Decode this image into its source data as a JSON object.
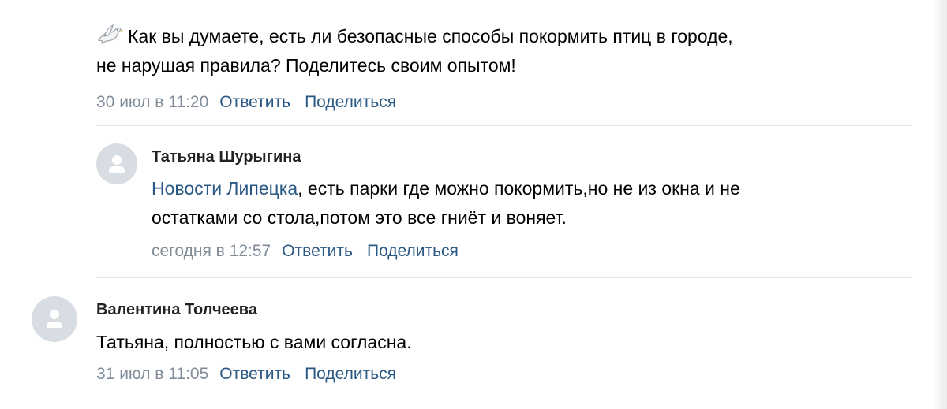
{
  "post": {
    "text_icon": "dove-icon",
    "text_line1": "Как вы думаете, есть ли безопасные способы покормить птиц в городе,",
    "text_line2": "не нарушая правила? Поделитесь своим опытом!",
    "date": "30 июл в 11:20",
    "reply_label": "Ответить",
    "share_label": "Поделиться"
  },
  "comments": [
    {
      "author": "Татьяна Шурыгина",
      "avatar_icon": "default-avatar-icon",
      "mention": "Новости Липецка",
      "text_line1_rest": ", есть парки где можно покормить,но не из окна и не",
      "text_line2": "остатками со стола,потом это все гниёт и воняет.",
      "date": "сегодня в 12:57",
      "reply_label": "Ответить",
      "share_label": "Поделиться"
    },
    {
      "author": "Валентина Толчеева",
      "avatar_icon": "default-avatar-icon",
      "text": "Татьяна, полностью с вами согласна.",
      "date": "31 июл в 11:05",
      "reply_label": "Ответить",
      "share_label": "Поделиться"
    }
  ],
  "colors": {
    "link": "#2a5885",
    "muted": "#818c99",
    "avatar_bg": "#d8dde4",
    "divider": "#e3e6e9"
  }
}
